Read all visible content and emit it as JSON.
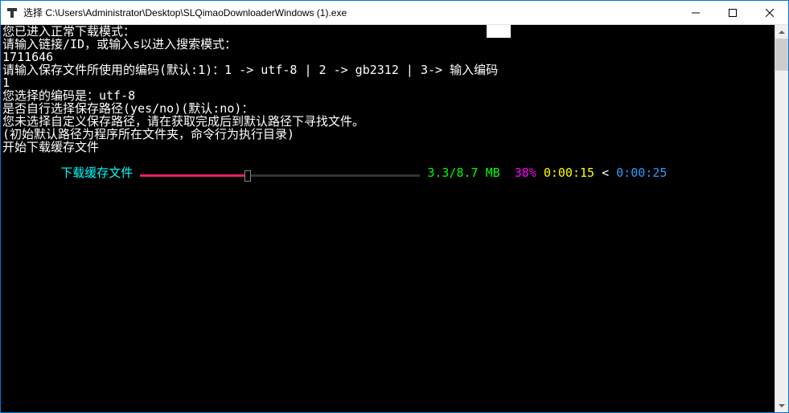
{
  "window": {
    "title": "选择 C:\\Users\\Administrator\\Desktop\\SLQimaoDownloaderWindows (1).exe"
  },
  "terminal": {
    "lines": {
      "l0": "您已进入正常下载模式：",
      "l1": "请输入链接/ID，或输入s以进入搜索模式：",
      "l2": "1711646",
      "l3": "请输入保存文件所使用的编码(默认:1)：1 -> utf-8 | 2 -> gb2312 | 3-> 输入编码",
      "l4": "1",
      "l5": "您选择的编码是：utf-8",
      "l6": "是否自行选择保存路径(yes/no)(默认:no)：",
      "l7": "您未选择自定义保存路径，请在获取完成后到默认路径下寻找文件。",
      "l8": "(初始默认路径为程序所在文件夹，命令行为执行目录)",
      "l9": "开始下载缓存文件"
    },
    "progress": {
      "label": "下载缓存文件 ",
      "size": " 3.3/8.7 MB ",
      "percent": " 38% ",
      "elapsed": "0:00:15",
      "separator": " < ",
      "remaining": "0:00:25"
    }
  }
}
